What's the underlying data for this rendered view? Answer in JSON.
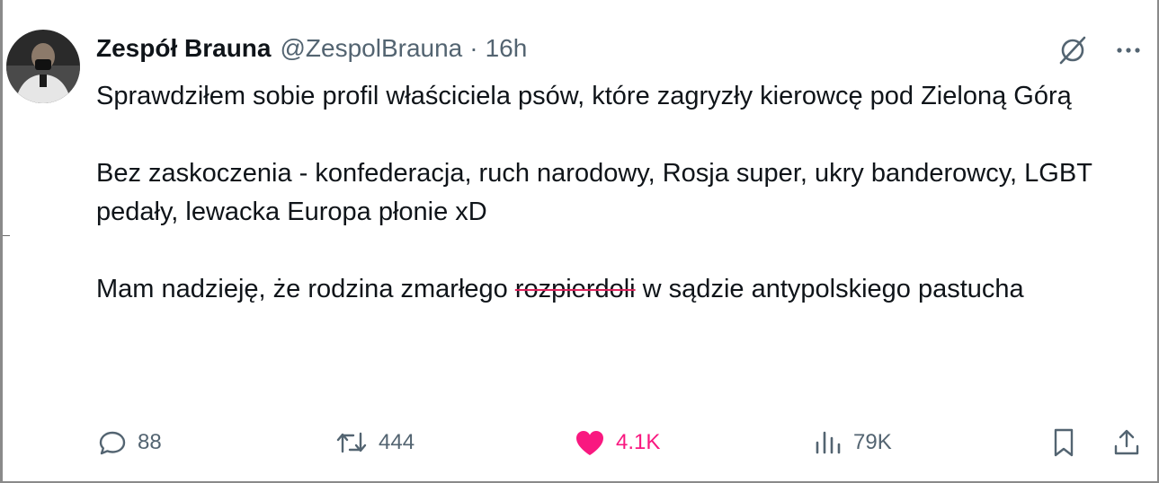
{
  "tweet": {
    "author_name": "Zespół Brauna",
    "author_handle": "@ZespolBrauna",
    "separator": "·",
    "time_ago": "16h",
    "paragraphs": {
      "p1": "Sprawdziłem sobie profil właściciela psów, które zagryzły kierowcę pod Zieloną Górą",
      "p2": "Bez zaskoczenia - konfederacja, ruch narodowy, Rosja super, ukry banderowcy, LGBT pedały, lewacka Europa płonie xD",
      "p3_before": "Mam nadzieję, że rodzina zmarłego ",
      "p3_struck": "rozpierdoli",
      "p3_after": " w sądzie antypolskiego pastucha"
    }
  },
  "actions": {
    "replies": "88",
    "reposts": "444",
    "likes": "4.1K",
    "views": "79K"
  },
  "colors": {
    "text": "#0f1419",
    "secondary": "#536471",
    "like": "#f91880",
    "strike": "#e0245e"
  },
  "icons": [
    "avatar",
    "grok-icon",
    "more-icon",
    "reply-icon",
    "repost-icon",
    "like-icon",
    "views-icon",
    "bookmark-icon",
    "share-icon"
  ]
}
